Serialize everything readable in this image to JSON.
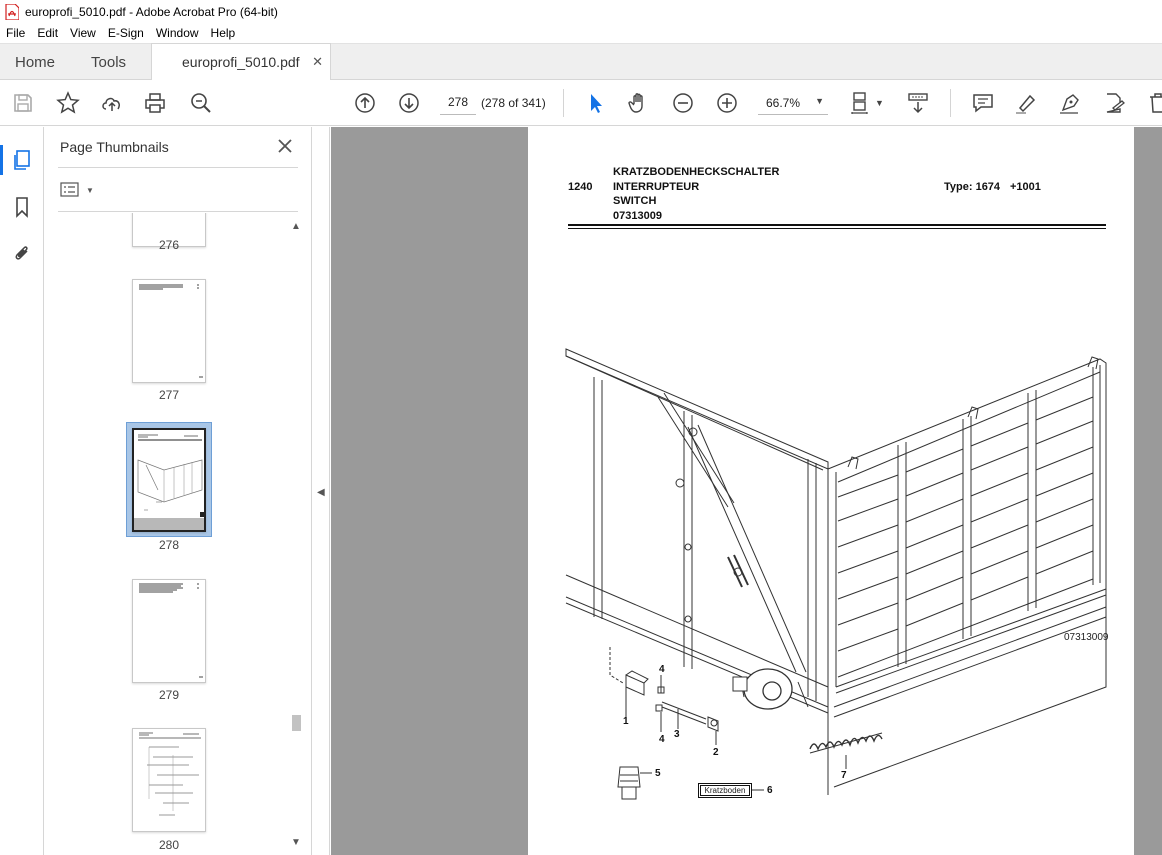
{
  "window": {
    "title": "europrofi_5010.pdf - Adobe Acrobat Pro (64-bit)"
  },
  "menu": [
    "File",
    "Edit",
    "View",
    "E-Sign",
    "Window",
    "Help"
  ],
  "tabs": {
    "home": "Home",
    "tools": "Tools",
    "document": "europrofi_5010.pdf"
  },
  "toolbar": {
    "page_number": "278",
    "page_count": "(278 of 341)",
    "zoom": "66.7%"
  },
  "thumbnails_panel": {
    "title": "Page Thumbnails",
    "pages": [
      {
        "label": "276"
      },
      {
        "label": "277"
      },
      {
        "label": "278",
        "selected": true
      },
      {
        "label": "279"
      },
      {
        "label": "280"
      }
    ]
  },
  "document_page": {
    "section_number": "1240",
    "title_de": "KRATZBODENHECKSCHALTER",
    "title_fr": "INTERRUPTEUR",
    "title_en": "SWITCH",
    "part_number": "07313009",
    "type_label": "Type: 1674",
    "type_range": "+1001",
    "drawing_ref": "07313009",
    "decal_text": "Kratzboden",
    "callouts": [
      "1",
      "2",
      "3",
      "4",
      "4",
      "5",
      "6",
      "7"
    ]
  },
  "colors": {
    "accent": "#1473e6",
    "doc_background": "#9a9a9a",
    "selected_thumb": "#a9c6e6"
  }
}
